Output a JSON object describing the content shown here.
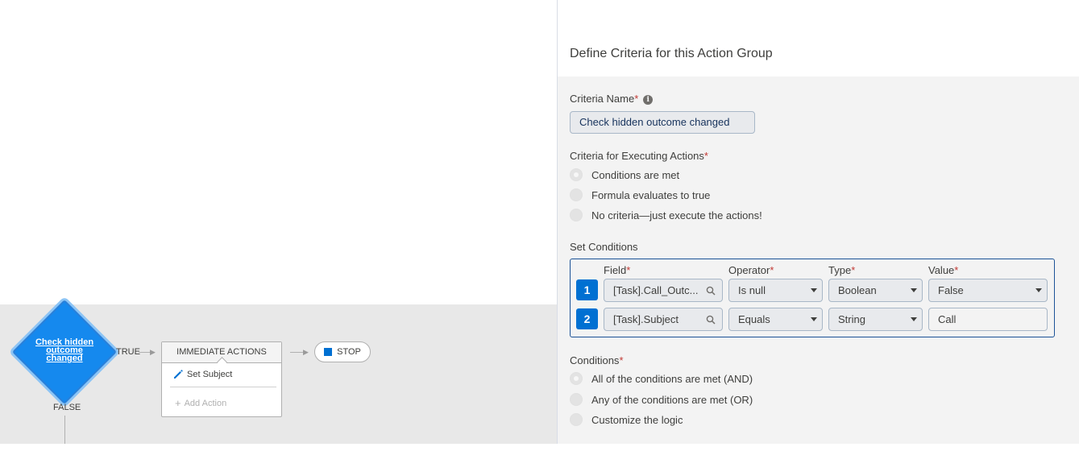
{
  "flow": {
    "criteria_node_label": "Check hidden outcome changed",
    "true_label": "TRUE",
    "false_label": "FALSE",
    "immediate_actions_title": "IMMEDIATE ACTIONS",
    "action_item": "Set Subject",
    "add_action": "Add Action",
    "stop_label": "STOP",
    "node_color": "#1589ee"
  },
  "panel": {
    "title": "Define Criteria for this Action Group",
    "criteria_name_label": "Criteria Name",
    "criteria_name_value": "Check hidden outcome changed",
    "executing_label": "Criteria for Executing Actions",
    "executing_options": [
      {
        "label": "Conditions are met",
        "selected": true
      },
      {
        "label": "Formula evaluates to true",
        "selected": false
      },
      {
        "label": "No criteria—just execute the actions!",
        "selected": false
      }
    ],
    "set_conditions_label": "Set Conditions",
    "columns": {
      "field": "Field",
      "operator": "Operator",
      "type": "Type",
      "value": "Value"
    },
    "rows": [
      {
        "num": "1",
        "field": "[Task].Call_Outc...",
        "operator": "Is null",
        "type": "Boolean",
        "value": "False"
      },
      {
        "num": "2",
        "field": "[Task].Subject",
        "operator": "Equals",
        "type": "String",
        "value": "Call"
      }
    ],
    "conditions_label": "Conditions",
    "conditions_options": [
      {
        "label": "All of the conditions are met (AND)",
        "selected": true
      },
      {
        "label": "Any of the conditions are met (OR)",
        "selected": false
      },
      {
        "label": "Customize the logic",
        "selected": false
      }
    ],
    "required_marker": "*",
    "accent_color": "#0070d2"
  }
}
